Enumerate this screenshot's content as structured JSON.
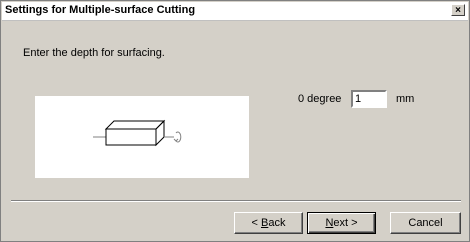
{
  "window": {
    "title": "Settings for Multiple-surface Cutting",
    "close_glyph": "×"
  },
  "instruction": "Enter the depth for surfacing.",
  "depth": {
    "angle_label": "0 degree",
    "value": "1",
    "unit": "mm"
  },
  "buttons": {
    "back": {
      "prefix": "< ",
      "mnemonic": "B",
      "rest": "ack"
    },
    "next": {
      "mnemonic": "N",
      "rest": "ext >"
    },
    "cancel": "Cancel"
  },
  "colors": {
    "dialog_bg": "#d4d0c8",
    "preview_bg": "#ffffff"
  }
}
